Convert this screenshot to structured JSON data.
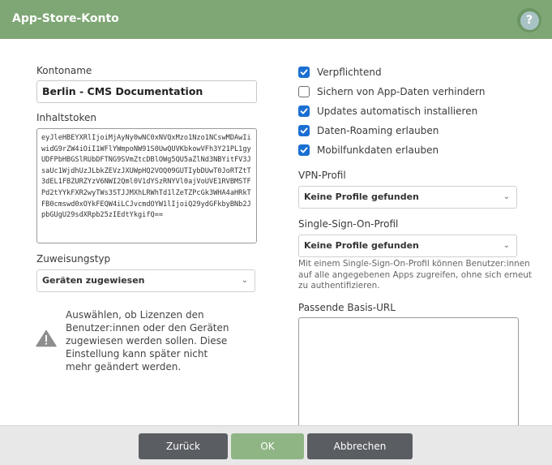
{
  "dialog": {
    "title": "App-Store-Konto",
    "help_label": "?"
  },
  "left": {
    "account_name_label": "Kontoname",
    "account_name_value": "Berlin - CMS Documentation",
    "token_label": "Inhaltstoken",
    "token_value": "eyJleHBEYXRlIjoiMjAyNy0wNC0xNVQxMzo1Nzo1NCswMDAwIiwidG9rZW4iOiI1WFlYWmpoNW91S0UwQUVKbkowVFh3Y21PL1gyUDFPbHBGSlRUbDFTNG9SVmZtcDBlOWg5QU5aZlNd3NBYitFV3JsaUc1WjdhUzJLbkZEVzJXUWpHQ2VOQ09GUTIybDUwT0JoRTZtT3dEL1FBZURZYzV6NWI2Qml0V1dYSzRNYVl0ajVoUVE1RVBMSTFPd2tYYkFXR2wyTWs3STJJMXhLRWhTd1lZeTZPcGk3WHA4aHRkTFB0cmswd0xOYkFEQW4iLCJvcmdOYW1lIjoiQ29ydGFkbyBNb2JpbGUgU29sdXRpb25zIEdtYkgifQ==",
    "assign_label": "Zuweisungstyp",
    "assign_value": "Geräten zugewiesen",
    "warning_text": "Auswählen, ob Lizenzen den Benutzer:innen oder den Geräten zugewiesen werden sollen. Diese Einstellung kann später nicht mehr geändert werden."
  },
  "right": {
    "checkboxes": [
      {
        "label": "Verpflichtend",
        "checked": true
      },
      {
        "label": "Sichern von App-Daten verhindern",
        "checked": false
      },
      {
        "label": "Updates automatisch installieren",
        "checked": true
      },
      {
        "label": "Daten-Roaming erlauben",
        "checked": true
      },
      {
        "label": "Mobilfunkdaten erlauben",
        "checked": true
      }
    ],
    "vpn_label": "VPN-Profil",
    "vpn_value": "Keine Profile gefunden",
    "sso_label": "Single-Sign-On-Profil",
    "sso_value": "Keine Profile gefunden",
    "sso_hint": "Mit einem Single-Sign-On-Profil können Benutzer:innen auf alle angegebenen Apps zugreifen, ohne sich erneut zu authentifizieren.",
    "url_label": "Passende Basis-URL",
    "url_value": ""
  },
  "footer": {
    "back_label": "Zurück",
    "ok_label": "OK",
    "cancel_label": "Abbrechen"
  },
  "colors": {
    "header": "#7fa675",
    "checkbox_accent": "#1a6fd3",
    "button_dark": "#5a5e63",
    "button_ok": "#8fb584"
  },
  "icons": {
    "help": "help-icon",
    "warning": "warning-icon",
    "chevron": "chevron-down-icon",
    "check": "check-icon"
  }
}
